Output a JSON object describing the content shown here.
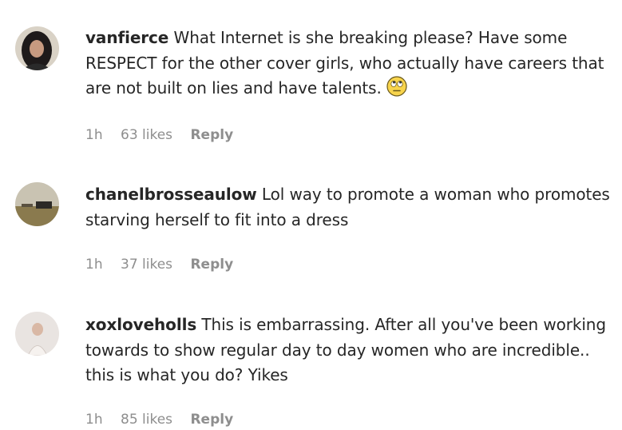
{
  "comments": [
    {
      "username": "vanfierce",
      "text": "What Internet is she breaking please? Have some RESPECT for the other cover girls, who actually have careers that are not built on lies and have talents.",
      "emoji": "face-with-rolling-eyes-icon",
      "time": "1h",
      "likes": "63 likes",
      "reply": "Reply"
    },
    {
      "username": "chanelbrosseaulow",
      "text": "Lol way to promote a woman who promotes starving herself to fit into a dress",
      "time": "1h",
      "likes": "37 likes",
      "reply": "Reply"
    },
    {
      "username": "xoxloveholls",
      "text": "This is embarrassing. After all you've been working towards to show regular day to day women who are incredible.. this is what you do? Yikes",
      "time": "1h",
      "likes": "85 likes",
      "reply": "Reply"
    }
  ]
}
